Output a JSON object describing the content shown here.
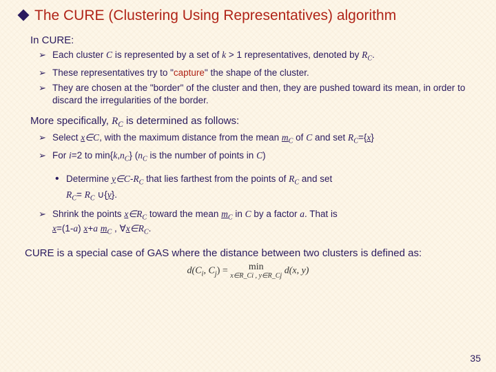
{
  "title": "The CURE (Clustering Using Representatives) algorithm",
  "section1": "In CURE:",
  "bul1a_pre": "Each cluster ",
  "bul1a_C": "C",
  "bul1a_mid1": " is represented by a set of ",
  "bul1a_k": "k",
  "bul1a_mid2": " > 1 representatives, denoted by ",
  "bul1a_R": "R",
  "bul1a_Cs": "C",
  "bul1a_end": ".",
  "bul1b_pre": "These representatives try to \"",
  "bul1b_cap": "capture",
  "bul1b_post": "\" the shape of the cluster.",
  "bul1c": "They are chosen at the \"border\" of the cluster and then, they are pushed toward its mean, in order to discard the irregularities of the border.",
  "section2_pre": "More specifically, ",
  "section2_R": "R",
  "section2_Cs": "C",
  "section2_post": " is determined as follows:",
  "b2a_1": "Select ",
  "b2a_x": "x",
  "b2a_2": "∈",
  "b2a_C": "C",
  "b2a_3": ", with the maximum distance from the mean ",
  "b2a_m": "m",
  "b2a_Cs": "C",
  "b2a_4": " of ",
  "b2a_C2": "C",
  "b2a_5": " and set ",
  "b2a_R": "R",
  "b2a_Cs2": "C",
  "b2a_6": "={",
  "b2a_x2": "x",
  "b2a_7": "}",
  "b2b_1": "For ",
  "b2b_i": "i",
  "b2b_2": "=2 to min{",
  "b2b_k": "k",
  "b2b_3": ",",
  "b2b_n": "n",
  "b2b_Cs": "C",
  "b2b_4": "}   (",
  "b2b_n2": "n",
  "b2b_Cs2": "C",
  "b2b_5": "  is the number of points in ",
  "b2b_C": "C",
  "b2b_6": ")",
  "dot_1": "Determine ",
  "dot_y": "y",
  "dot_2": "∈",
  "dot_C": "C",
  "dot_3": "-",
  "dot_R": "R",
  "dot_Cs": "C",
  "dot_4": " that lies farthest from the points of ",
  "dot_R2": "R",
  "dot_Cs2": "C",
  "dot_5": " and set",
  "dot_line2a": "R",
  "dot_line2Cs": "C",
  "dot_line2b": "= ",
  "dot_line2R": "R",
  "dot_line2Cs2": "C",
  "dot_line2c": " ∪{",
  "dot_line2y": "y",
  "dot_line2d": "}.",
  "b2c_1": "Shrink the points ",
  "b2c_x": "x",
  "b2c_2": "∈",
  "b2c_R": "R",
  "b2c_Cs": "C",
  "b2c_3": " toward the mean ",
  "b2c_m": "m",
  "b2c_Cs2": "C",
  "b2c_4": " in ",
  "b2c_C": "C",
  "b2c_5": " by a factor ",
  "b2c_a": "a",
  "b2c_6": ". That  is",
  "b2c_line2a": "x",
  "b2c_line2b": "=(1-",
  "b2c_line2a2": "a",
  "b2c_line2c": ") ",
  "b2c_line2x": "x",
  "b2c_line2d": "+",
  "b2c_line2a3": "a",
  "b2c_line2e": " ",
  "b2c_line2m": "m",
  "b2c_line2Cs": "C",
  "b2c_line2f": " , ∀",
  "b2c_line2x2": "x",
  "b2c_line2g": "∈",
  "b2c_line2R": "R",
  "b2c_line2Cs2": "C",
  "b2c_line2h": ".",
  "footer": "CURE is a special case of GAS where the distance between two clusters is defined as:",
  "formula_lhs": "d(C",
  "formula_i": "i",
  "formula_mid": ", C",
  "formula_j": "j",
  "formula_rhs1": ") = ",
  "formula_min": "min",
  "formula_cond": "x∈R_Ci , y∈R_Cj",
  "formula_rhs2": " d(x, y)",
  "pagenum": "35"
}
